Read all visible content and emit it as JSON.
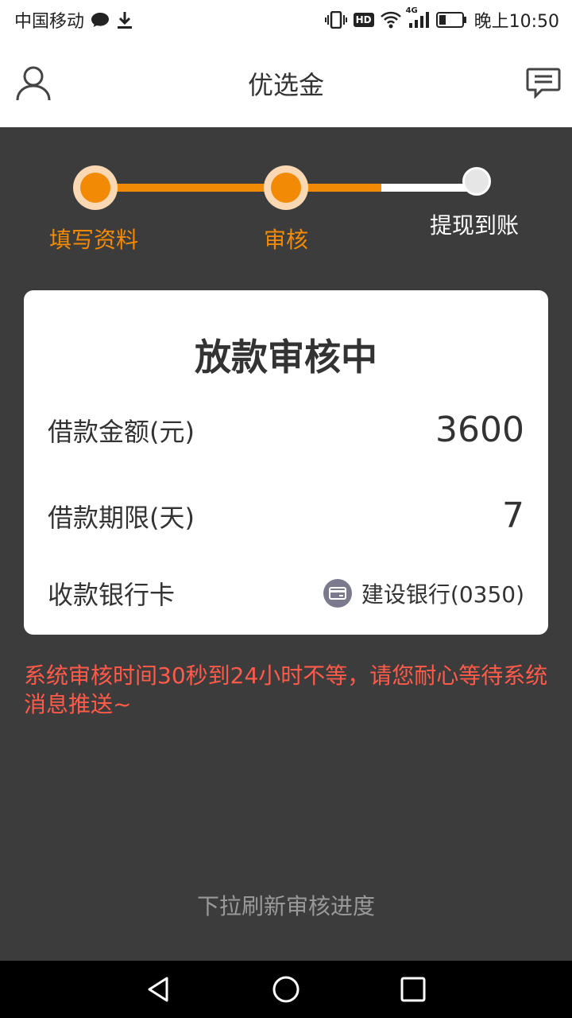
{
  "status_bar": {
    "carrier": "中国移动",
    "network": "4G",
    "hd": "HD",
    "time": "晚上10:50"
  },
  "header": {
    "title": "优选金"
  },
  "steps": [
    {
      "label": "填写资料",
      "state": "done"
    },
    {
      "label": "审核",
      "state": "current"
    },
    {
      "label": "提现到账",
      "state": "pending"
    }
  ],
  "card": {
    "title": "放款审核中",
    "amount_label": "借款金额(元)",
    "amount_value": "3600",
    "term_label": "借款期限(天)",
    "term_value": "7",
    "bank_label": "收款银行卡",
    "bank_value": "建设银行(0350)"
  },
  "notice": "系统审核时间30秒到24小时不等，请您耐心等待系统消息推送~",
  "pull_hint": "下拉刷新审核进度",
  "colors": {
    "accent": "#f28a05",
    "accent_light": "#fbd8b4",
    "background": "#3c3c3c",
    "warning": "#ff5a4a"
  }
}
